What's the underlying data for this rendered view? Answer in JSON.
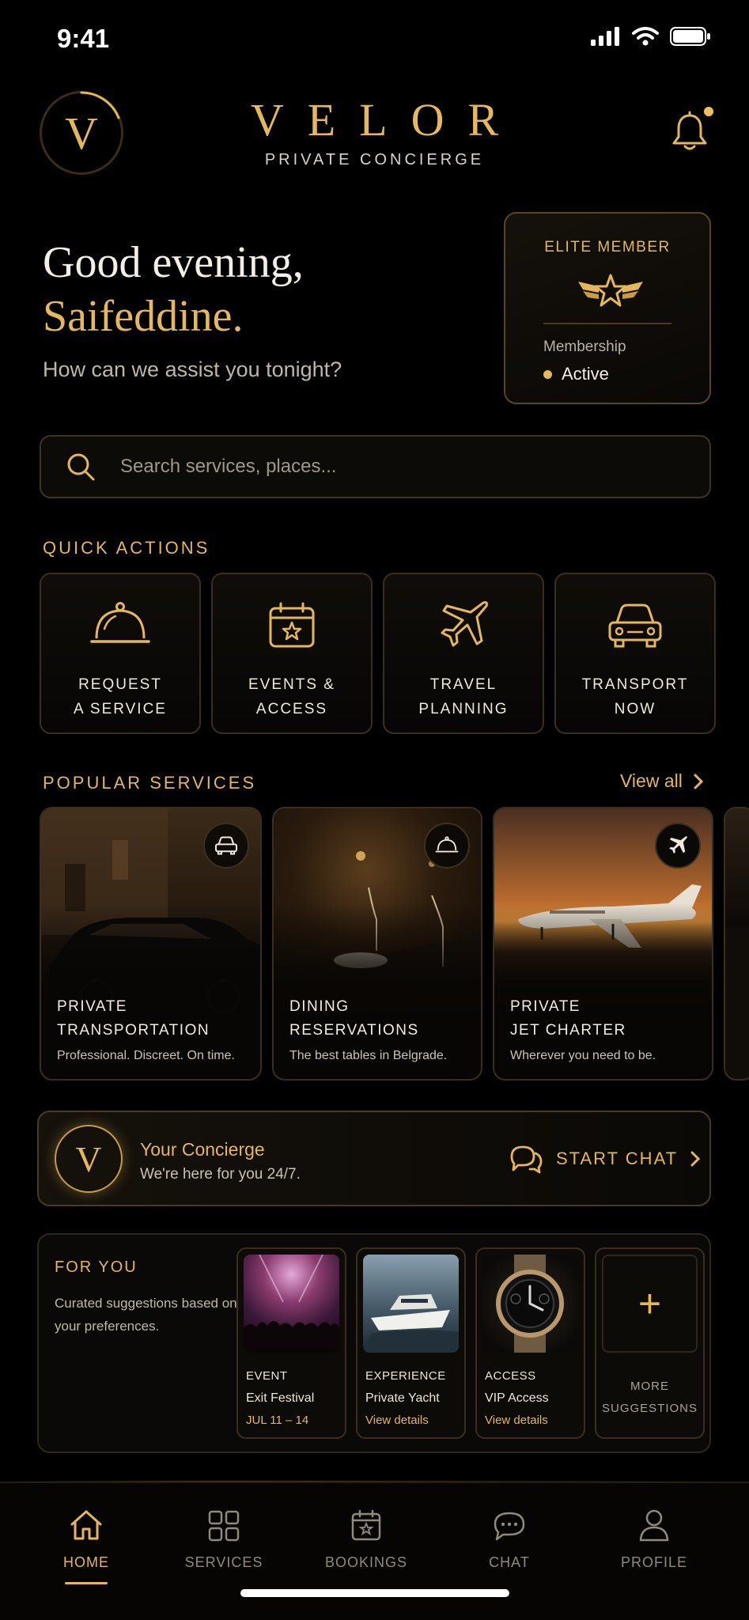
{
  "status_bar": {
    "time": "9:41"
  },
  "header": {
    "logo_letter": "V",
    "brand_title": "VELOR",
    "brand_subtitle": "PRIVATE CONCIERGE",
    "notification_icon": "bell-icon"
  },
  "greeting": {
    "line1": "Good evening,",
    "name": "Saifeddine.",
    "subtitle": "How can we assist you tonight?"
  },
  "membership": {
    "tier": "ELITE MEMBER",
    "label": "Membership",
    "status": "Active"
  },
  "search": {
    "placeholder": "Search services, places..."
  },
  "quick_actions": {
    "label": "QUICK ACTIONS",
    "items": [
      {
        "label": "REQUEST\nA SERVICE",
        "icon": "cloche-icon"
      },
      {
        "label": "EVENTS &\nACCESS",
        "icon": "calendar-star-icon"
      },
      {
        "label": "TRAVEL\nPLANNING",
        "icon": "airplane-icon"
      },
      {
        "label": "TRANSPORT\nNOW",
        "icon": "car-icon"
      }
    ]
  },
  "popular_services": {
    "label": "POPULAR SERVICES",
    "view_all": "View all",
    "cards": [
      {
        "title": "PRIVATE\nTRANSPORTATION",
        "description": "Professional. Discreet. On time.",
        "icon": "car-icon"
      },
      {
        "title": "DINING\nRESERVATIONS",
        "description": "The best tables in Belgrade.",
        "icon": "cloche-icon"
      },
      {
        "title": "PRIVATE\nJET CHARTER",
        "description": "Wherever you need to be.",
        "icon": "airplane-icon"
      }
    ]
  },
  "concierge": {
    "letter": "V",
    "title": "Your Concierge",
    "subtitle": "We're here for you 24/7.",
    "button": "START CHAT"
  },
  "for_you": {
    "label": "FOR YOU",
    "description": "Curated suggestions based on your preferences.",
    "items": [
      {
        "category": "EVENT",
        "name": "Exit Festival",
        "meta": "JUL 11 – 14"
      },
      {
        "category": "EXPERIENCE",
        "name": "Private Yacht",
        "meta": "View details"
      },
      {
        "category": "ACCESS",
        "name": "VIP Access",
        "meta": "View details"
      }
    ],
    "more": {
      "plus": "+",
      "label": "MORE\nSUGGESTIONS"
    }
  },
  "tabs": [
    {
      "label": "HOME",
      "icon": "home-icon",
      "active": true
    },
    {
      "label": "SERVICES",
      "icon": "grid-icon"
    },
    {
      "label": "BOOKINGS",
      "icon": "calendar-icon"
    },
    {
      "label": "CHAT",
      "icon": "chat-bubble-icon"
    },
    {
      "label": "PROFILE",
      "icon": "person-icon"
    }
  ],
  "colors": {
    "accent": "#e3b75a",
    "background": "#000000",
    "card_border": "#3a2f1e"
  }
}
